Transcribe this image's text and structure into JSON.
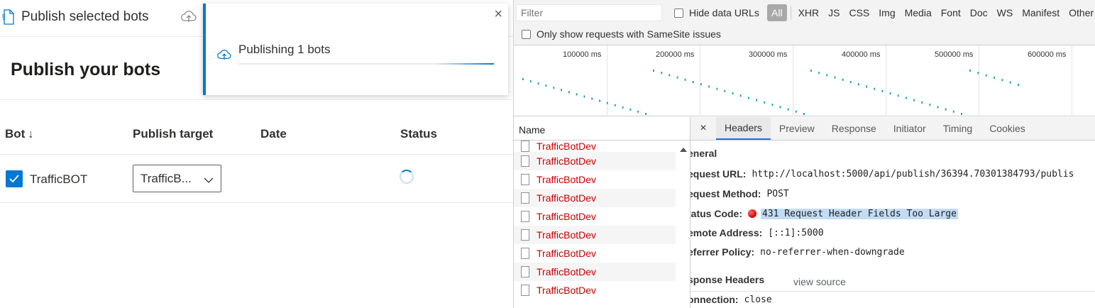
{
  "app": {
    "toolbar": {
      "publish_label": "Publish selected bots"
    },
    "page_title": "Publish your bots",
    "table": {
      "headers": {
        "bot": "Bot",
        "sort_glyph": "↓",
        "target": "Publish target",
        "date": "Date",
        "status": "Status"
      },
      "rows": [
        {
          "bot": "TrafficBOT",
          "checked": true,
          "target": "TrafficB...",
          "date": "",
          "status": "loading"
        }
      ]
    },
    "notification": {
      "text": "Publishing 1 bots",
      "close": "×",
      "progress": 0.23
    }
  },
  "devtools": {
    "filter_placeholder": "Filter",
    "hide_data_urls": "Hide data URLs",
    "type_filters": [
      "All",
      "XHR",
      "JS",
      "CSS",
      "Img",
      "Media",
      "Font",
      "Doc",
      "WS",
      "Manifest",
      "Other"
    ],
    "active_filter": "All",
    "samesite_label": "Only show requests with SameSite issues",
    "timeline_ticks": [
      "100000 ms",
      "200000 ms",
      "300000 ms",
      "400000 ms",
      "500000 ms",
      "600000 ms"
    ],
    "name_header": "Name",
    "requests": [
      "TrafficBotDev",
      "TrafficBotDev",
      "TrafficBotDev",
      "TrafficBotDev",
      "TrafficBotDev",
      "TrafficBotDev",
      "TrafficBotDev",
      "TrafficBotDev",
      "TrafficBotDev"
    ],
    "tabs": [
      "Headers",
      "Preview",
      "Response",
      "Initiator",
      "Timing",
      "Cookies"
    ],
    "active_tab": "Headers",
    "close_glyph": "×",
    "general_title": "eneral",
    "general": [
      {
        "key": "equest URL:",
        "value": "http://localhost:5000/api/publish/36394.70301384793/publis"
      },
      {
        "key": "equest Method:",
        "value": "POST"
      },
      {
        "key": "tatus Code:",
        "value": "431 Request Header Fields Too Large"
      },
      {
        "key": "emote Address:",
        "value": "[::1]:5000"
      },
      {
        "key": "eferrer Policy:",
        "value": "no-referrer-when-downgrade"
      }
    ],
    "response_headers_title": "sponse Headers",
    "view_source": "view source",
    "response_headers": [
      {
        "key": "onnection:",
        "value": "close"
      }
    ],
    "colors": {
      "error_red": "#c80000",
      "waterfall": "#23a2b5",
      "accent": "#0078d4"
    }
  }
}
